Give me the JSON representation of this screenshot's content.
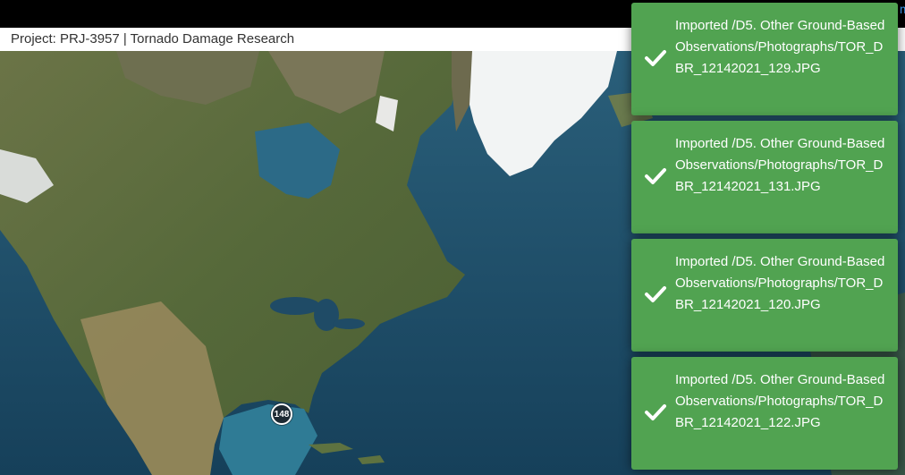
{
  "header": {
    "project_title": "Project: PRJ-3957 | Tornado Damage Research"
  },
  "map": {
    "cluster_count": "148",
    "colors": {
      "ocean": "#1b4e6b",
      "land": "#5f6f3e",
      "ice": "#f2f4f4",
      "cluster": "#1d2a33"
    }
  },
  "toasts": [
    {
      "icon": "check-icon",
      "message": "Imported /D5. Other Ground-Based Observations/Photographs/TOR_DBR_12142021_129.JPG"
    },
    {
      "icon": "check-icon",
      "message": "Imported /D5. Other Ground-Based Observations/Photographs/TOR_DBR_12142021_131.JPG"
    },
    {
      "icon": "check-icon",
      "message": "Imported /D5. Other Ground-Based Observations/Photographs/TOR_DBR_12142021_120.JPG"
    },
    {
      "icon": "check-icon",
      "message": "Imported /D5. Other Ground-Based Observations/Photographs/TOR_DBR_12142021_122.JPG"
    }
  ],
  "toast_color": "#51a351"
}
